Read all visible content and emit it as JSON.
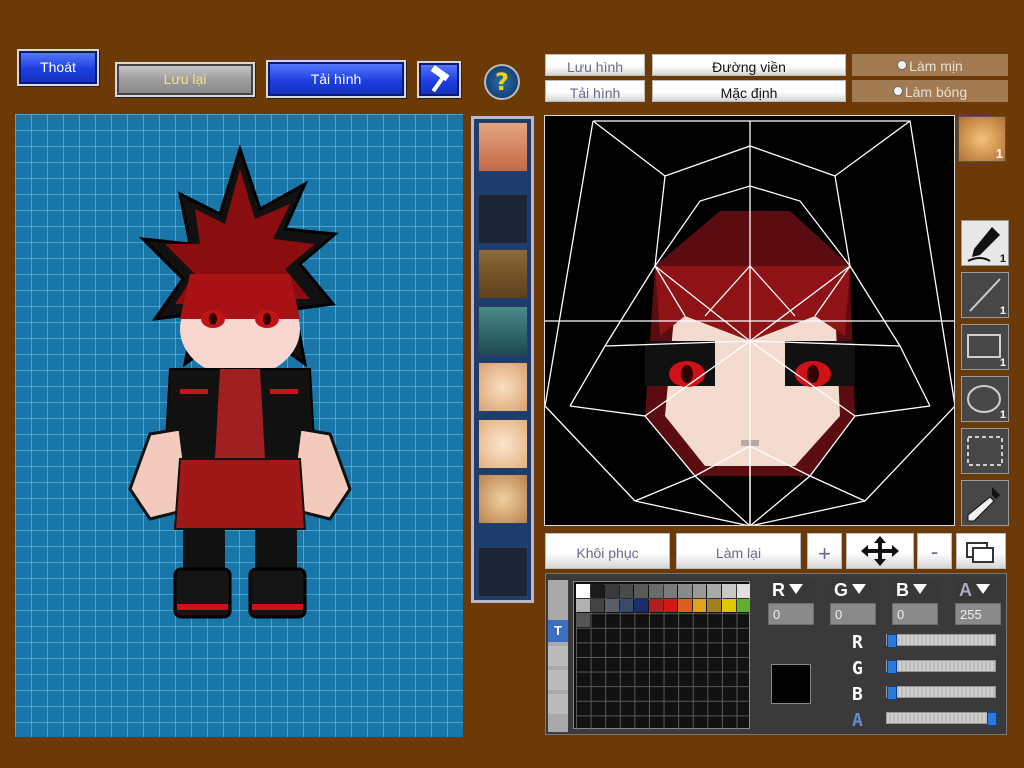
{
  "toolbar": {
    "exit_label": "Thoát",
    "save_label": "Lưu lại",
    "load_label": "Tải hình",
    "help_glyph": "?"
  },
  "editor_tabs": {
    "save_image": "Lưu hình",
    "load_image": "Tải hình",
    "outline": "Đường viền",
    "default": "Mặc định",
    "smooth": "Làm mịn",
    "shade": "Làm bóng"
  },
  "tools": [
    {
      "icon": "pen-icon",
      "count": "1"
    },
    {
      "icon": "line-icon",
      "count": "1"
    },
    {
      "icon": "rectangle-icon",
      "count": "1"
    },
    {
      "icon": "ellipse-icon",
      "count": "1"
    },
    {
      "icon": "selection-icon",
      "count": ""
    },
    {
      "icon": "eyedropper-icon",
      "count": ""
    }
  ],
  "face_preset_badge": "1",
  "actions": {
    "restore": "Khôi phục",
    "redo": "Làm lại",
    "plus": "+",
    "minus": "-"
  },
  "palette_tab": "T",
  "palette_colors": [
    "#ffffff",
    "#1a1a1a",
    "#3a3a3a",
    "#4a4a4a",
    "#5a5a5a",
    "#6a6a6a",
    "#7a7a7a",
    "#8a8a8a",
    "#9a9a9a",
    "#aaaaaa",
    "#c8c8c8",
    "#e0e0e0",
    "#b0b0b0",
    "#444444",
    "#5a5f6a",
    "#3a4a6a",
    "#1a2e6a",
    "#b02020",
    "#d01818",
    "#d86020",
    "#e0a020",
    "#a08020",
    "#e0c800",
    "#60b030",
    "#555555"
  ],
  "color_channels": {
    "r": {
      "label": "R",
      "value": "0"
    },
    "g": {
      "label": "G",
      "value": "0"
    },
    "b": {
      "label": "B",
      "value": "0"
    },
    "a": {
      "label": "A",
      "value": "255"
    }
  },
  "slider_levels": {
    "r": 0,
    "g": 0,
    "b": 0,
    "a": 1
  },
  "current_color": "#000000",
  "accent_colors": {
    "background": "#6b3a06",
    "button_blue": "#1d3ee0",
    "canvas_blue": "#1877a8"
  }
}
